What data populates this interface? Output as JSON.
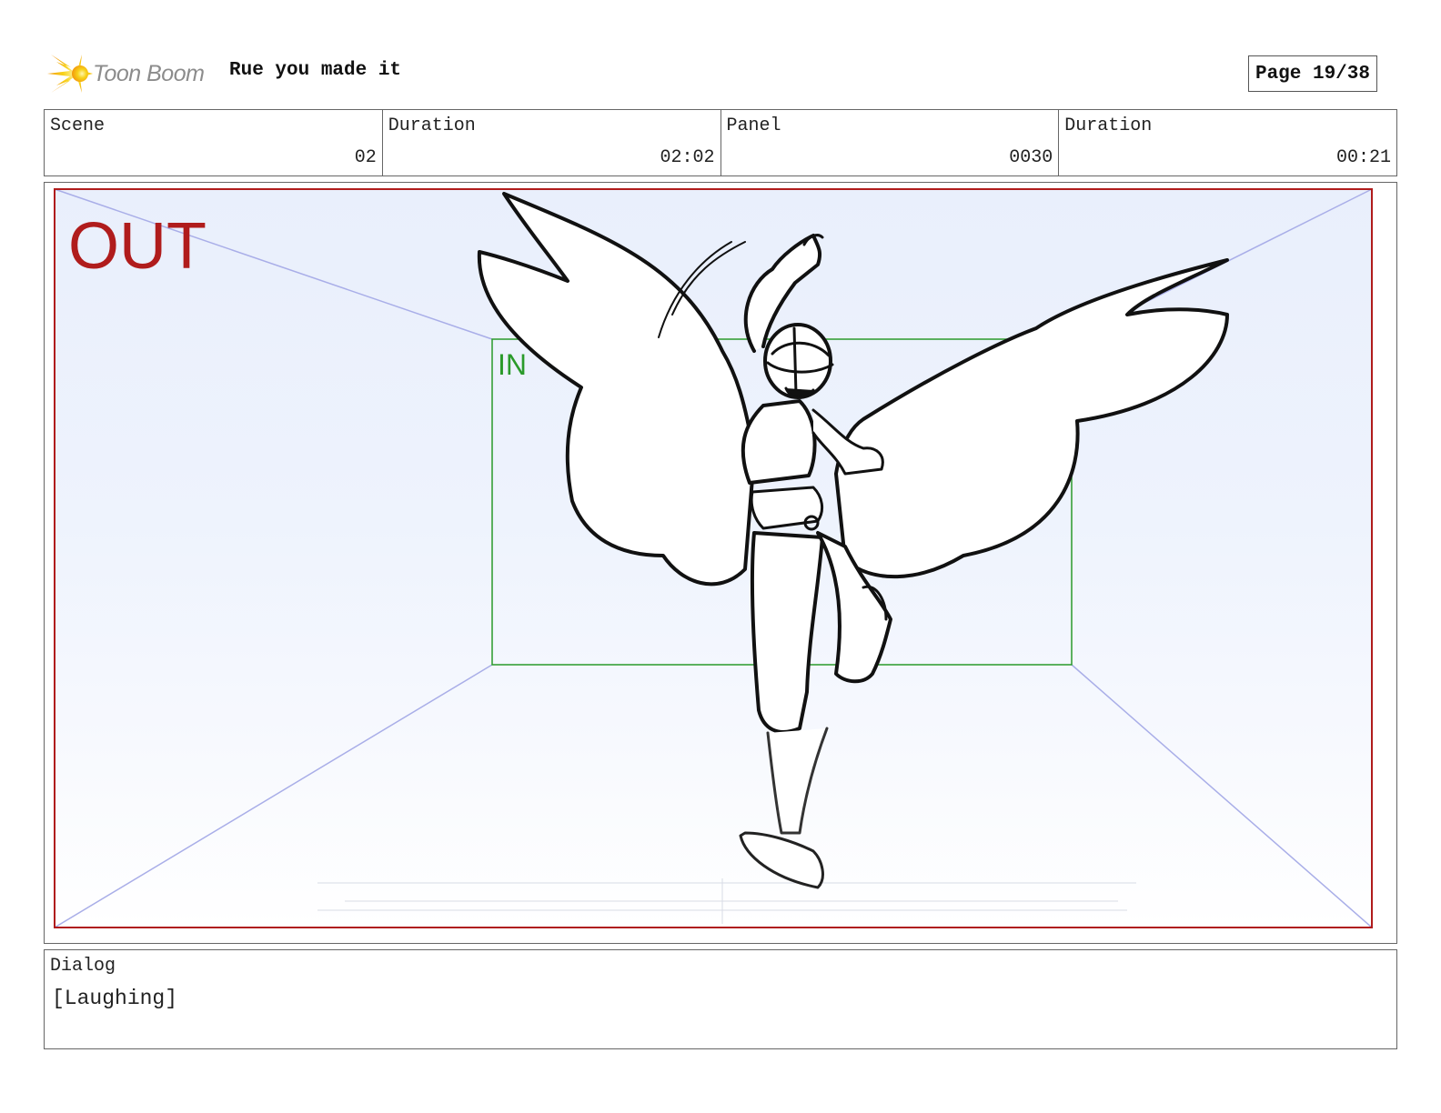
{
  "header": {
    "logo_text": "Toon Boom",
    "title": "Rue you made it",
    "page": "Page 19/38"
  },
  "info": [
    {
      "label": "Scene",
      "value": "02"
    },
    {
      "label": "Duration",
      "value": "02:02"
    },
    {
      "label": "Panel",
      "value": "0030"
    },
    {
      "label": "Duration",
      "value": "00:21"
    }
  ],
  "frame": {
    "out_label": "OUT",
    "in_label": "IN",
    "out_color": "#b01c1c",
    "in_color": "#2a9a2a",
    "guide_color": "#a9aee8",
    "background_color": "#eef3fd"
  },
  "dialog": {
    "label": "Dialog",
    "text": "[Laughing]"
  },
  "icons": {
    "logo": "starburst-icon"
  }
}
